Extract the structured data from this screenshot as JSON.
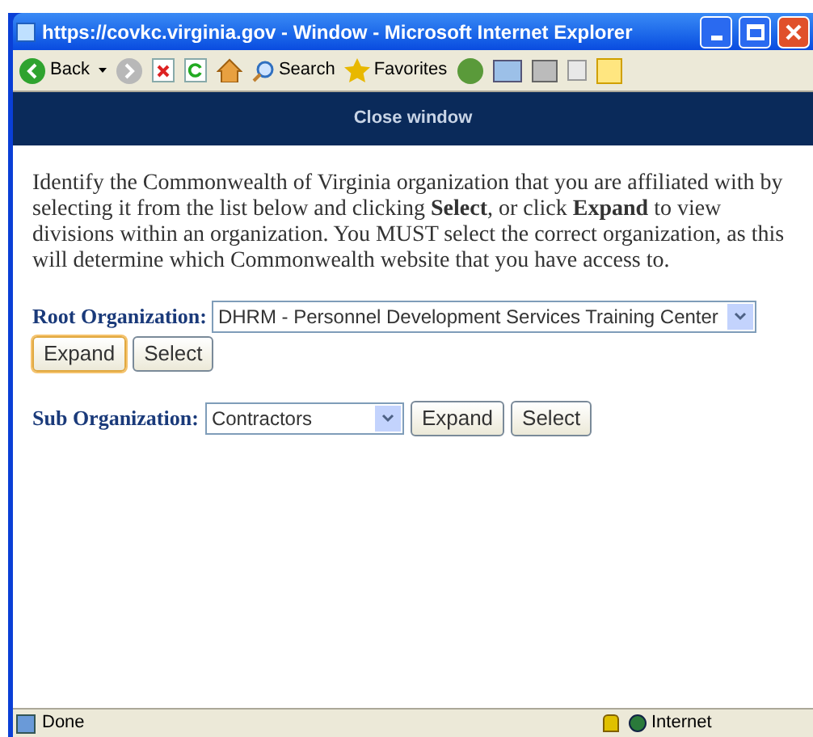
{
  "window": {
    "title": "https://covkc.virginia.gov - Window - Microsoft Internet Explorer"
  },
  "toolbar": {
    "back": "Back",
    "search": "Search",
    "favorites": "Favorites"
  },
  "banner": {
    "link": "Close window"
  },
  "instructions": "Identify the Commonwealth of Virginia organization that you are affiliated with by selecting it from the list below and clicking **Select**, or click **Expand** to view divisions within an organization. You MUST select the correct organization, as this will determine which Commonwealth website that you have access to.",
  "root": {
    "label": "Root Organization:",
    "value": "DHRM - Personnel Development Services Training Center",
    "buttons": [
      {
        "label": "Expand",
        "focused": true
      },
      {
        "label": "Select",
        "focused": false
      }
    ]
  },
  "sub": {
    "label": "Sub Organization:",
    "value": "Contractors",
    "buttons": [
      {
        "label": "Expand",
        "focused": false
      },
      {
        "label": "Select",
        "focused": false
      }
    ]
  },
  "status_bar": {
    "status": "Done",
    "zone": "Internet"
  }
}
